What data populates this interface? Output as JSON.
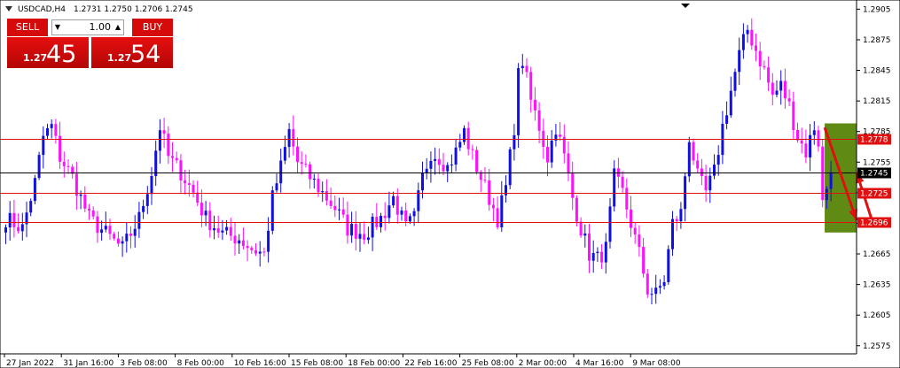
{
  "header": {
    "title": "USDCAD,H4",
    "ohlc": "1.2731 1.2750 1.2706 1.2745"
  },
  "trade_panel": {
    "sell_label": "SELL",
    "buy_label": "BUY",
    "lot_value": "1.00",
    "sell_price_small": "1.27",
    "sell_price_big": "45",
    "buy_price_small": "1.27",
    "buy_price_big": "54",
    "colors": {
      "button": "#d50a0a",
      "text": "#ffffff"
    }
  },
  "chart_data": {
    "type": "candlestick",
    "symbol": "USDCAD",
    "timeframe": "H4",
    "y_ticks": [
      "1.2905",
      "1.2875",
      "1.2845",
      "1.2815",
      "1.2785",
      "1.2755",
      "1.2725",
      "1.2695",
      "1.2665",
      "1.2635",
      "1.2605",
      "1.2575"
    ],
    "ylim": [
      1.2567,
      1.2914
    ],
    "x_ticks": [
      "27 Jan 2022",
      "31 Jan 16:00",
      "3 Feb 08:00",
      "8 Feb 00:00",
      "10 Feb 16:00",
      "15 Feb 08:00",
      "18 Feb 00:00",
      "22 Feb 16:00",
      "25 Feb 08:00",
      "2 Mar 00:00",
      "4 Mar 16:00",
      "9 Mar 08:00"
    ],
    "anchors": [
      [
        0,
        1.27
      ],
      [
        4,
        1.269
      ],
      [
        7,
        1.2735
      ],
      [
        9,
        1.278
      ],
      [
        11,
        1.279
      ],
      [
        13,
        1.276
      ],
      [
        16,
        1.274
      ],
      [
        18,
        1.272
      ],
      [
        20,
        1.27
      ],
      [
        24,
        1.2685
      ],
      [
        28,
        1.267
      ],
      [
        32,
        1.27
      ],
      [
        35,
        1.2745
      ],
      [
        37,
        1.279
      ],
      [
        39,
        1.276
      ],
      [
        42,
        1.2745
      ],
      [
        45,
        1.2725
      ],
      [
        48,
        1.27
      ],
      [
        52,
        1.2685
      ],
      [
        56,
        1.268
      ],
      [
        59,
        1.267
      ],
      [
        62,
        1.2665
      ],
      [
        64,
        1.272
      ],
      [
        66,
        1.275
      ],
      [
        68,
        1.2785
      ],
      [
        70,
        1.2755
      ],
      [
        73,
        1.274
      ],
      [
        76,
        1.2725
      ],
      [
        79,
        1.271
      ],
      [
        82,
        1.269
      ],
      [
        86,
        1.2685
      ],
      [
        90,
        1.27
      ],
      [
        93,
        1.272
      ],
      [
        96,
        1.269
      ],
      [
        98,
        1.27
      ],
      [
        100,
        1.274
      ],
      [
        102,
        1.2765
      ],
      [
        104,
        1.276
      ],
      [
        106,
        1.275
      ],
      [
        108,
        1.2765
      ],
      [
        110,
        1.2785
      ],
      [
        112,
        1.276
      ],
      [
        114,
        1.274
      ],
      [
        116,
        1.272
      ],
      [
        118,
        1.27
      ],
      [
        120,
        1.273
      ],
      [
        122,
        1.279
      ],
      [
        123,
        1.284
      ],
      [
        124,
        1.2855
      ],
      [
        126,
        1.2815
      ],
      [
        128,
        1.279
      ],
      [
        130,
        1.276
      ],
      [
        132,
        1.279
      ],
      [
        134,
        1.276
      ],
      [
        136,
        1.272
      ],
      [
        138,
        1.269
      ],
      [
        140,
        1.2665
      ],
      [
        142,
        1.266
      ],
      [
        144,
        1.267
      ],
      [
        146,
        1.274
      ],
      [
        148,
        1.2725
      ],
      [
        150,
        1.2695
      ],
      [
        152,
        1.2665
      ],
      [
        154,
        1.263
      ],
      [
        156,
        1.2625
      ],
      [
        158,
        1.264
      ],
      [
        160,
        1.2695
      ],
      [
        162,
        1.2705
      ],
      [
        164,
        1.278
      ],
      [
        166,
        1.274
      ],
      [
        168,
        1.2725
      ],
      [
        170,
        1.2745
      ],
      [
        172,
        1.279
      ],
      [
        174,
        1.2825
      ],
      [
        176,
        1.286
      ],
      [
        178,
        1.2885
      ],
      [
        180,
        1.2865
      ],
      [
        182,
        1.2845
      ],
      [
        184,
        1.282
      ],
      [
        186,
        1.283
      ],
      [
        188,
        1.281
      ],
      [
        190,
        1.278
      ],
      [
        192,
        1.2765
      ],
      [
        194,
        1.279
      ],
      [
        195,
        1.2775
      ],
      [
        196,
        1.2715
      ],
      [
        198,
        1.2745
      ]
    ],
    "horizontal_lines": [
      {
        "price": 1.2778,
        "color": "#e01010",
        "label": "1.2778"
      },
      {
        "price": 1.2745,
        "color": "#000000",
        "label": "1.2745"
      },
      {
        "price": 1.2725,
        "color": "#e01010",
        "label": "1.2725"
      },
      {
        "price": 1.2696,
        "color": "#e01010",
        "label": "1.2696"
      }
    ],
    "zone": {
      "color": "#5f8a14",
      "x0": 196.5,
      "x1": 999,
      "y_top": 1.2793,
      "y_bottom": 1.2686
    },
    "arrows": [
      {
        "from": [
          196.5,
          1.2789
        ],
        "to": [
          207,
          1.2698
        ],
        "color": "#e01010"
      },
      {
        "from": [
          208,
          1.2696
        ],
        "to": [
          999,
          1.2745
        ],
        "color": "#e01010"
      }
    ],
    "colors": {
      "bull": "#1010e0",
      "bear": "#ff10ff",
      "grid": "#000000"
    }
  }
}
